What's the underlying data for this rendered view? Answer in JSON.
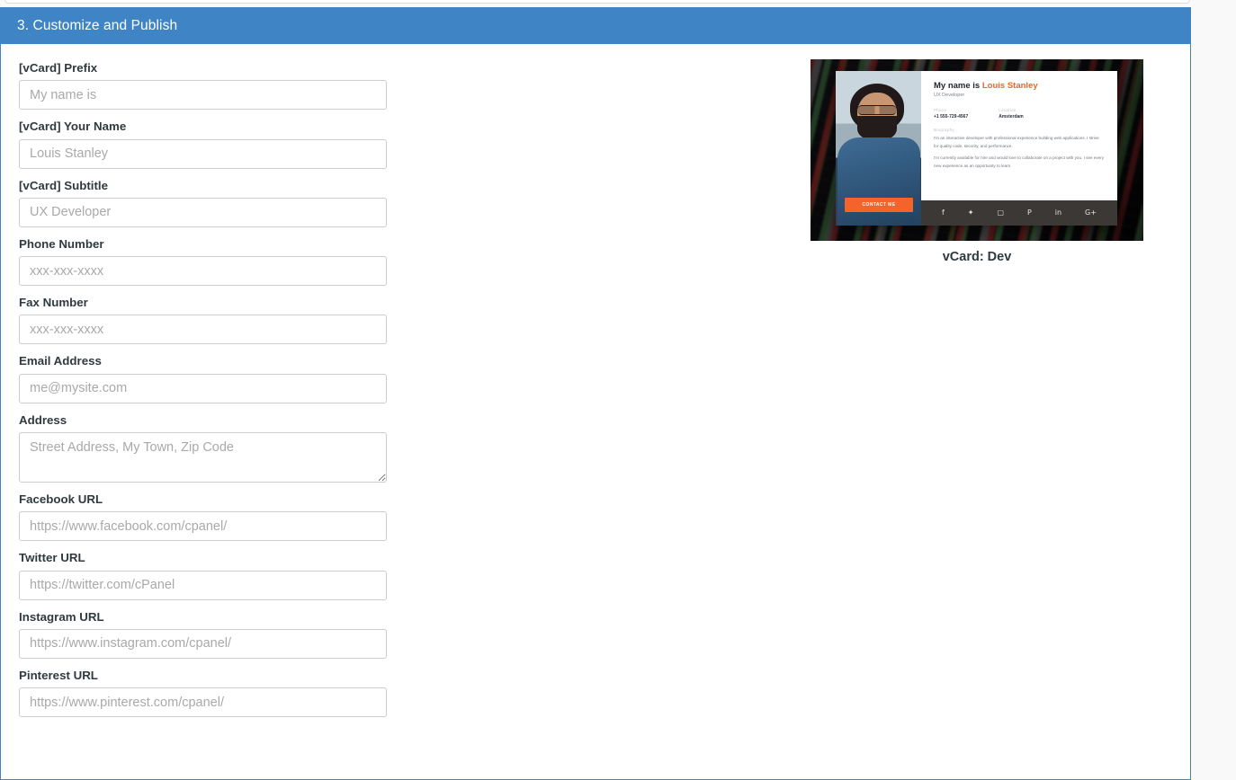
{
  "panel": {
    "header_title": "3. Customize and Publish"
  },
  "form": {
    "fields": [
      {
        "label": "[vCard] Prefix",
        "placeholder": "My name is",
        "value": "",
        "type": "text"
      },
      {
        "label": "[vCard] Your Name",
        "placeholder": "Louis Stanley",
        "value": "",
        "type": "text"
      },
      {
        "label": "[vCard] Subtitle",
        "placeholder": "UX Developer",
        "value": "",
        "type": "text"
      },
      {
        "label": "Phone Number",
        "placeholder": "xxx-xxx-xxxx",
        "value": "",
        "type": "text"
      },
      {
        "label": "Fax Number",
        "placeholder": "xxx-xxx-xxxx",
        "value": "",
        "type": "text"
      },
      {
        "label": "Email Address",
        "placeholder": "me@mysite.com",
        "value": "",
        "type": "text"
      },
      {
        "label": "Address",
        "placeholder": "Street Address, My Town, Zip Code",
        "value": "",
        "type": "textarea"
      },
      {
        "label": "Facebook URL",
        "placeholder": "https://www.facebook.com/cpanel/",
        "value": "",
        "type": "text"
      },
      {
        "label": "Twitter URL",
        "placeholder": "https://twitter.com/cPanel",
        "value": "",
        "type": "text"
      },
      {
        "label": "Instagram URL",
        "placeholder": "https://www.instagram.com/cpanel/",
        "value": "",
        "type": "text"
      },
      {
        "label": "Pinterest URL",
        "placeholder": "https://www.pinterest.com/cpanel/",
        "value": "",
        "type": "text"
      }
    ]
  },
  "preview": {
    "caption": "vCard: Dev",
    "card": {
      "name_prefix": "My name is",
      "name": "Louis Stanley",
      "subtitle": "UX Developer",
      "phone_label": "Phone",
      "phone_value": "+1 555-729-4567",
      "location_label": "Location",
      "location_value": "Amsterdam",
      "biography_label": "Biography",
      "bio_paragraph_1": "I'm an interactive developer with professional experience building web applications. I strive for quality code, security, and performance.",
      "bio_paragraph_2": "I'm currently available for hire and would love to collaborate on a project with you. I see every new experience as an opportunity to learn.",
      "contact_button": "CONTACT ME",
      "social_icons": [
        "facebook-icon",
        "twitter-icon",
        "instagram-icon",
        "pinterest-icon",
        "linkedin-icon",
        "googleplus-icon"
      ],
      "social_glyphs": [
        "f",
        "✦",
        "▢",
        "P",
        "in",
        "G+"
      ]
    }
  },
  "colors": {
    "header_blue": "#3f85c6",
    "panel_border": "#3f85c6",
    "page_background": "#f9f9f9",
    "input_border": "#cccccc",
    "placeholder": "#a9a9a9",
    "label_text": "#2f3a3f",
    "accent_orange": "#f4642a",
    "social_bar": "#3b3836"
  }
}
